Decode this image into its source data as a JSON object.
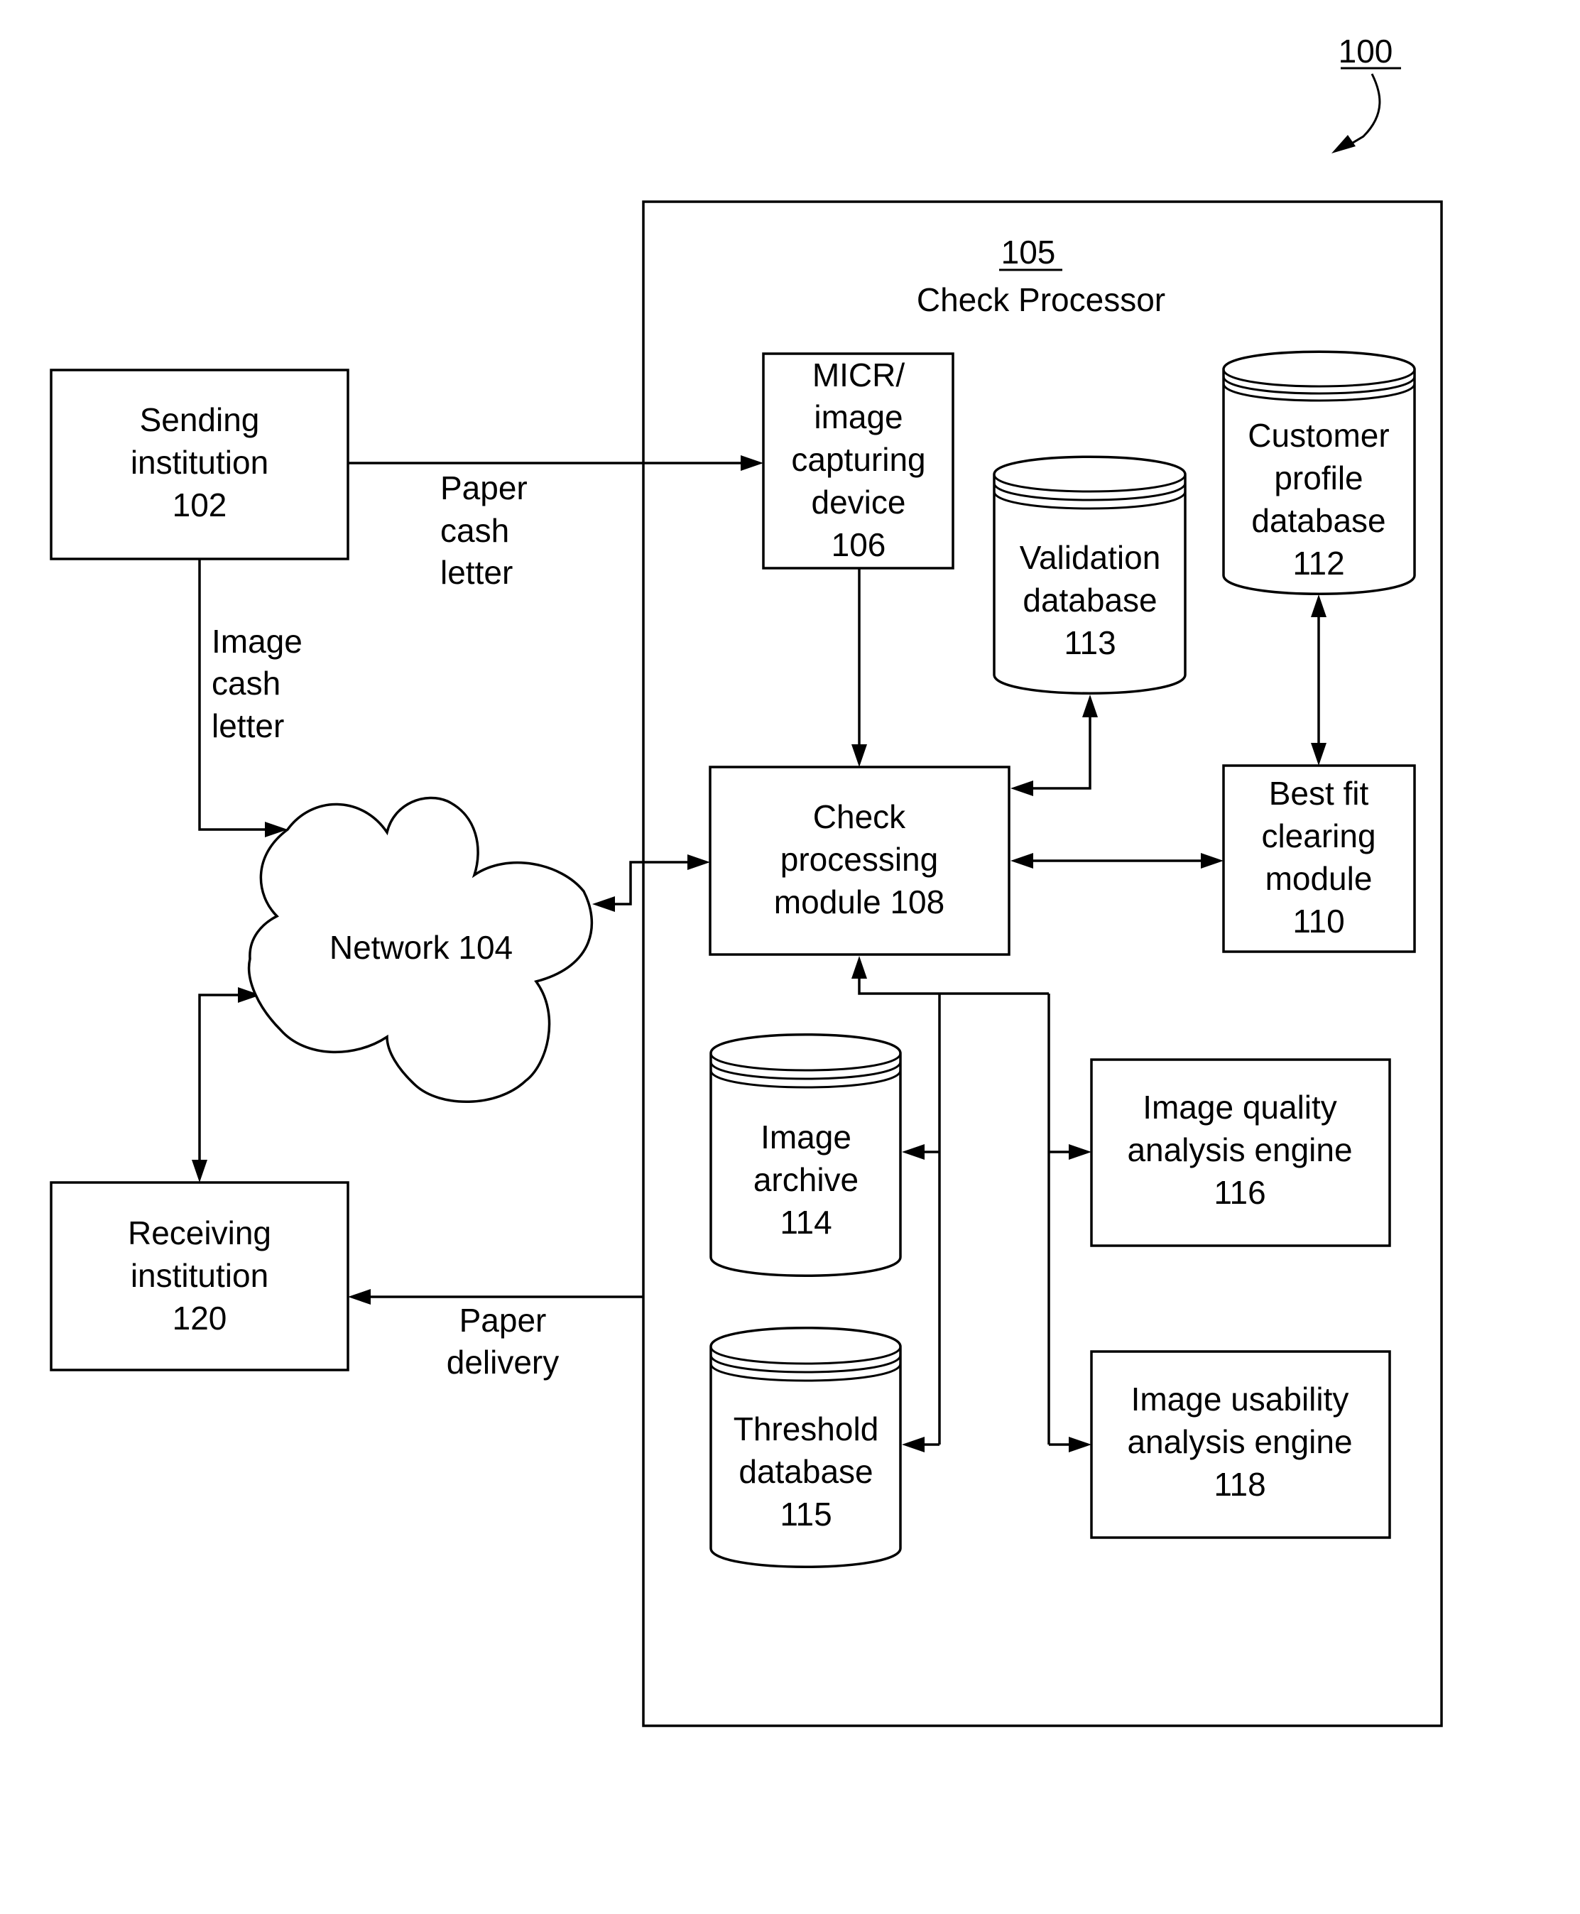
{
  "figure": {
    "ref": "100",
    "container": {
      "ref": "105",
      "title": "Check Processor"
    }
  },
  "nodes": {
    "sending": {
      "lines": [
        "Sending",
        "institution",
        "102"
      ],
      "shape": "box"
    },
    "network": {
      "lines": [
        "Network 104"
      ],
      "shape": "cloud"
    },
    "receiving": {
      "lines": [
        "Receiving",
        "institution",
        "120"
      ],
      "shape": "box"
    },
    "micr": {
      "lines": [
        "MICR/",
        "image",
        "capturing",
        "device",
        "106"
      ],
      "shape": "box"
    },
    "validation_db": {
      "lines": [
        "Validation",
        "database",
        "113"
      ],
      "shape": "database"
    },
    "customer_db": {
      "lines": [
        "Customer",
        "profile",
        "database",
        "112"
      ],
      "shape": "database"
    },
    "check_processing": {
      "lines": [
        "Check",
        "processing",
        "module 108"
      ],
      "shape": "box"
    },
    "best_fit": {
      "lines": [
        "Best fit",
        "clearing",
        "module",
        "110"
      ],
      "shape": "box"
    },
    "image_archive": {
      "lines": [
        "Image",
        "archive",
        "114"
      ],
      "shape": "database"
    },
    "threshold_db": {
      "lines": [
        "Threshold",
        "database",
        "115"
      ],
      "shape": "database"
    },
    "quality_engine": {
      "lines": [
        "Image quality",
        "analysis engine",
        "116"
      ],
      "shape": "box"
    },
    "usability_engine": {
      "lines": [
        "Image usability",
        "analysis engine",
        "118"
      ],
      "shape": "box"
    }
  },
  "edge_labels": {
    "paper_cash_letter": [
      "Paper",
      "cash",
      "letter"
    ],
    "image_cash_letter": [
      "Image",
      "cash",
      "letter"
    ],
    "paper_delivery": [
      "Paper",
      "delivery"
    ]
  },
  "edges": [
    {
      "from": "sending",
      "to": "micr",
      "label": "Paper cash letter",
      "direction": "forward"
    },
    {
      "from": "sending",
      "to": "network",
      "label": "Image cash letter",
      "direction": "forward"
    },
    {
      "from": "network",
      "to": "check_processing",
      "direction": "both"
    },
    {
      "from": "network",
      "to": "receiving",
      "direction": "both"
    },
    {
      "from": "micr",
      "to": "check_processing",
      "direction": "forward"
    },
    {
      "from": "check_processing",
      "to": "validation_db",
      "direction": "both"
    },
    {
      "from": "check_processing",
      "to": "best_fit",
      "direction": "both"
    },
    {
      "from": "best_fit",
      "to": "customer_db",
      "direction": "both"
    },
    {
      "from": "check_processing",
      "to": "image_archive",
      "direction": "both"
    },
    {
      "from": "check_processing",
      "to": "threshold_db",
      "direction": "both"
    },
    {
      "from": "check_processing",
      "to": "quality_engine",
      "direction": "both"
    },
    {
      "from": "check_processing",
      "to": "usability_engine",
      "direction": "both"
    },
    {
      "from": "container",
      "to": "receiving",
      "label": "Paper delivery",
      "direction": "forward"
    }
  ]
}
